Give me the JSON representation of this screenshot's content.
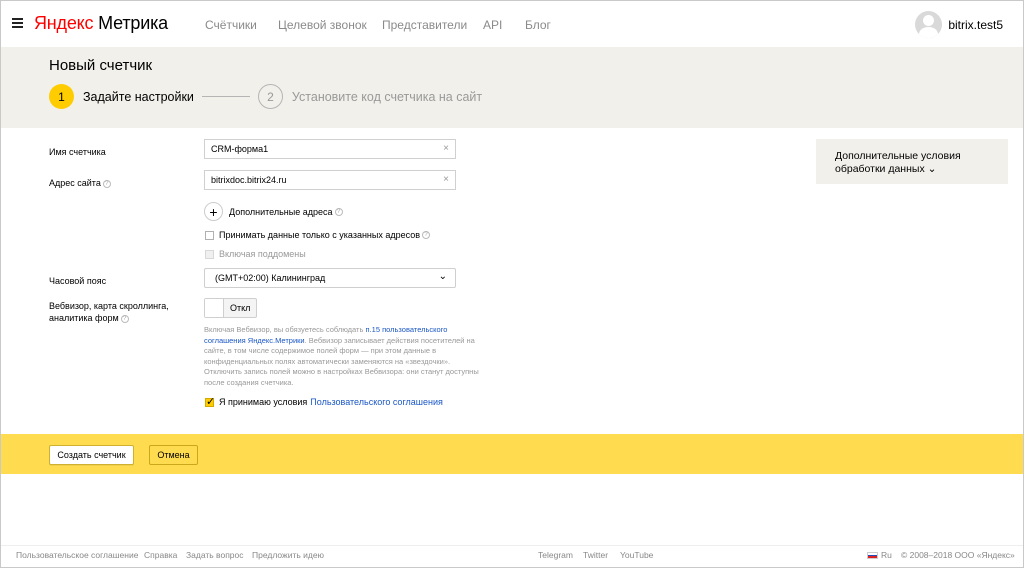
{
  "header": {
    "logo_ya": "Яндекс",
    "logo_rest": "Метрика",
    "nav": [
      "Счётчики",
      "Целевой звонок",
      "Представители",
      "API",
      "Блог"
    ],
    "username": "bitrix.test5"
  },
  "title": "Новый счетчик",
  "steps": [
    {
      "num": "1",
      "label": "Задайте настройки"
    },
    {
      "num": "2",
      "label": "Установите код счетчика на сайт"
    }
  ],
  "form": {
    "name_label": "Имя счетчика",
    "name_value": "CRM-форма1",
    "site_label": "Адрес сайта",
    "site_value": "bitrixdoc.bitrix24.ru",
    "clear_icon": "×",
    "add_addresses": "Дополнительные адреса",
    "accept_only": "Принимать данные только с указанных адресов",
    "include_subdomains": "Включая поддомены",
    "timezone_label": "Часовой пояс",
    "timezone_value": "(GMT+02:00) Калининград",
    "webvisor_label": "Вебвизор, карта скроллинга, аналитика форм",
    "webvisor_toggle": "Откл",
    "notice_part1": "Включая Вебвизор, вы обязуетесь соблюдать ",
    "notice_link": "п.15 пользовательского соглашения Яндекс.Метрики",
    "notice_part2": ". Вебвизор записывает действия посетителей на сайте, в том числе содержимое полей форм — при этом данные в конфиденциальных полях автоматически заменяются на «звездочки». Отключить запись полей можно в настройках Вебвизора: они станут доступны после создания счетчика.",
    "agree_text": "Я принимаю условия",
    "agree_link": "Пользовательского соглашения"
  },
  "side_box": {
    "line1": "Дополнительные условия",
    "line2": "обработки данных"
  },
  "actions": {
    "create": "Создать счетчик",
    "cancel": "Отмена"
  },
  "footer": {
    "links": [
      "Пользовательское соглашение",
      "Справка",
      "Задать вопрос",
      "Предложить идею"
    ],
    "social": [
      "Telegram",
      "Twitter",
      "YouTube"
    ],
    "lang": "Ru",
    "copyright": "© 2008–2018 ООО «Яндекс»"
  },
  "colors": {
    "accent": "#ffcc00",
    "band": "#fedb4f",
    "link": "#1a57c6",
    "panel": "#f2f0eb"
  }
}
